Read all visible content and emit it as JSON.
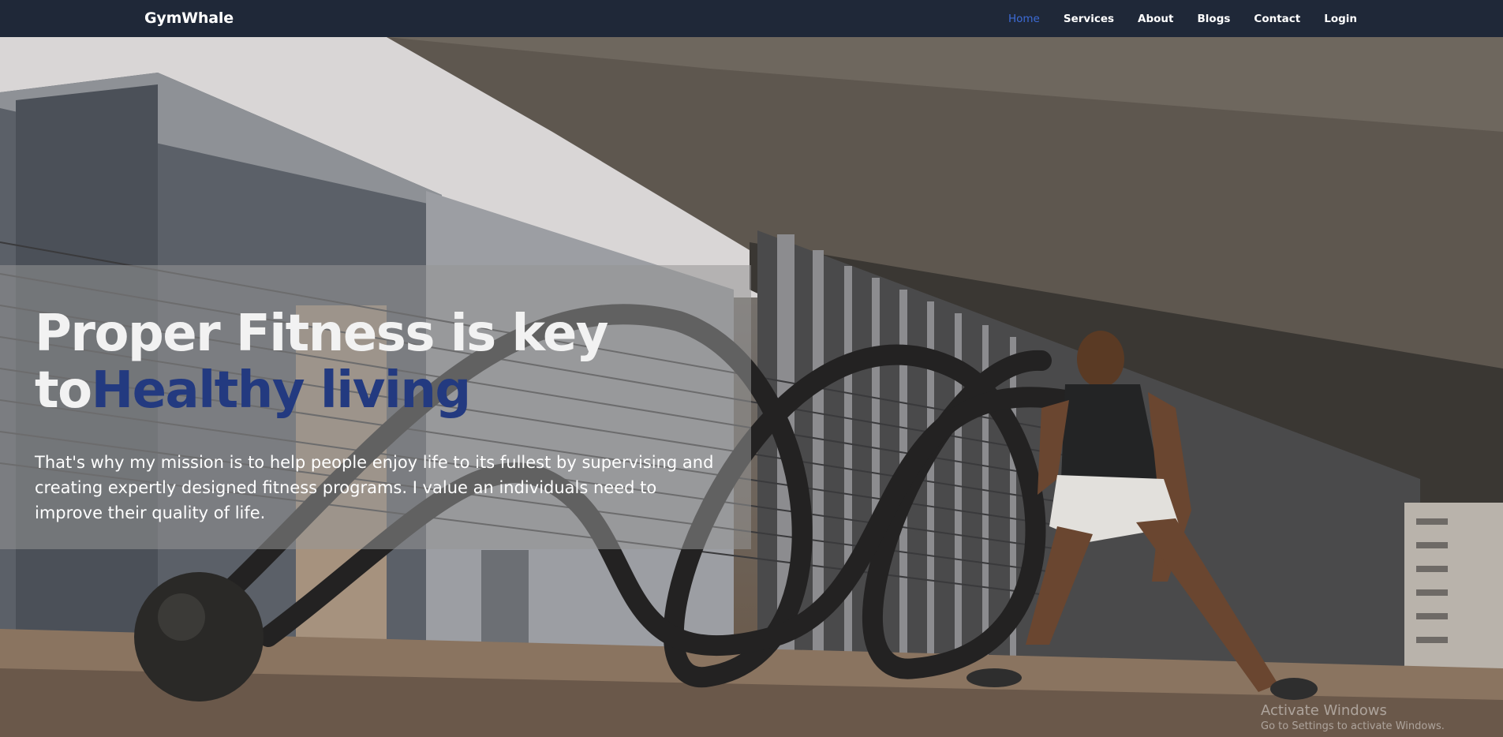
{
  "navbar": {
    "brand": "GymWhale",
    "links": [
      {
        "label": "Home",
        "active": true
      },
      {
        "label": "Services"
      },
      {
        "label": "About"
      },
      {
        "label": "Blogs"
      },
      {
        "label": "Contact"
      },
      {
        "label": "Login"
      }
    ]
  },
  "hero": {
    "headline_line1": "Proper Fitness is key",
    "headline_line2_prefix": "to",
    "headline_line2_accent": "Healthy living",
    "description": "That's why my mission is to help people enjoy life to its fullest by supervising and creating expertly designed fitness programs. I value an individuals need to improve their quality of life."
  },
  "watermark": {
    "title": "Activate Windows",
    "subtitle": "Go to Settings to activate Windows."
  },
  "colors": {
    "navbar_bg": "#1f2838",
    "active_link": "#3d6bd6",
    "accent_text": "#233a80"
  }
}
